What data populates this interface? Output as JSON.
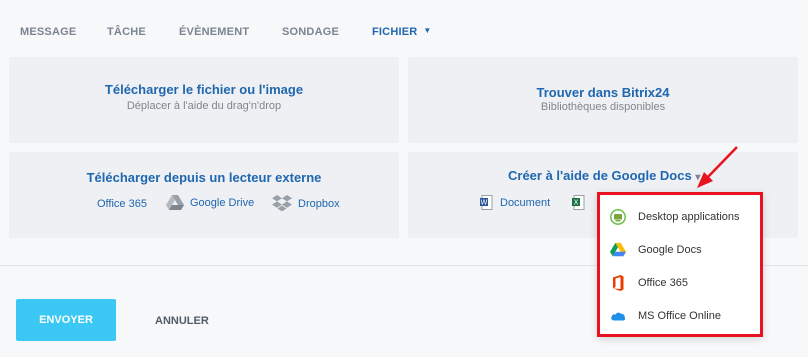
{
  "tabs": [
    {
      "label": "MESSAGE"
    },
    {
      "label": "TÂCHE"
    },
    {
      "label": "ÉVÈNEMENT"
    },
    {
      "label": "SONDAGE"
    },
    {
      "label": "FICHIER",
      "caret": "▼"
    }
  ],
  "cards": {
    "upload": {
      "title": "Télécharger le fichier ou l'image",
      "subtitle": "Déplacer à l'aide du drag'n'drop"
    },
    "find": {
      "title": "Trouver dans Bitrix24",
      "subtitle": "Bibliothèques disponibles"
    },
    "external": {
      "title": "Télécharger depuis un lecteur externe",
      "services": [
        "Office 365",
        "Google Drive",
        "Dropbox"
      ]
    },
    "create": {
      "title": "Créer à l'aide de Google Docs",
      "caret": "▾",
      "options": [
        "Document"
      ]
    }
  },
  "menu": {
    "items": [
      {
        "label": "Desktop applications",
        "icon": "desktop-app-icon"
      },
      {
        "label": "Google Docs",
        "icon": "google-drive-icon"
      },
      {
        "label": "Office 365",
        "icon": "office365-icon"
      },
      {
        "label": "MS Office Online",
        "icon": "onedrive-cloud-icon"
      }
    ]
  },
  "actions": {
    "send": "ENVOYER",
    "cancel": "ANNULER"
  },
  "colors": {
    "accent": "#2067b0",
    "button": "#3bc8f5",
    "highlight": "#e8131e"
  }
}
